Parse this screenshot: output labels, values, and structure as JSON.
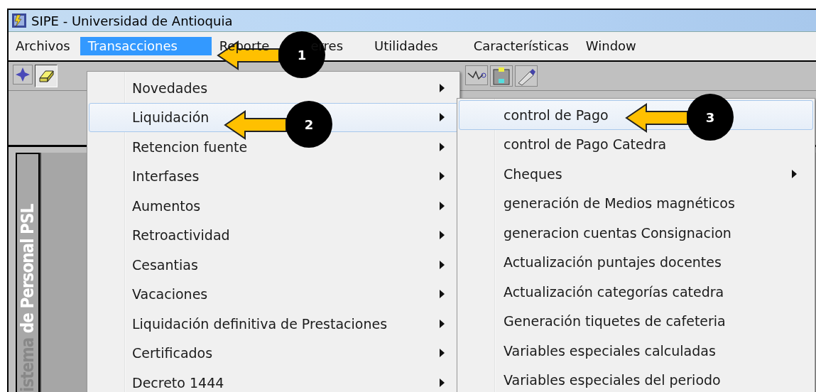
{
  "window": {
    "title": "SIPE - Universidad de Antioquia"
  },
  "menu_bar": [
    {
      "label": "Archivos",
      "selected": false
    },
    {
      "label": "Transacciones",
      "selected": true
    },
    {
      "label": "Reporte",
      "selected": false
    },
    {
      "label": "erres",
      "selected": false
    },
    {
      "label": "Utilidades",
      "selected": false
    },
    {
      "label": "Características",
      "selected": false
    },
    {
      "label": "Window",
      "selected": false
    }
  ],
  "side_banner": {
    "dim_part": "istema",
    "bright_part": "de Personal PSL"
  },
  "menu": [
    {
      "label": "Novedades",
      "selected": false,
      "submenu": true
    },
    {
      "label": "Liquidación",
      "selected": true,
      "submenu": true
    },
    {
      "label": "Retencion fuente",
      "selected": false,
      "submenu": true
    },
    {
      "label": "Interfases",
      "selected": false,
      "submenu": true
    },
    {
      "label": "Aumentos",
      "selected": false,
      "submenu": true
    },
    {
      "label": "Retroactividad",
      "selected": false,
      "submenu": true
    },
    {
      "label": "Cesantias",
      "selected": false,
      "submenu": true
    },
    {
      "label": "Vacaciones",
      "selected": false,
      "submenu": true
    },
    {
      "label": "Liquidación definitiva de Prestaciones",
      "selected": false,
      "submenu": true
    },
    {
      "label": "Certificados",
      "selected": false,
      "submenu": true
    },
    {
      "label": "Decreto 1444",
      "selected": false,
      "submenu": true
    }
  ],
  "submenu": [
    {
      "label": "control de Pago",
      "selected": true,
      "submenu": false
    },
    {
      "label": "control de Pago Catedra",
      "selected": false,
      "submenu": false
    },
    {
      "label": "Cheques",
      "selected": false,
      "submenu": true
    },
    {
      "label": "generación de Medios magnéticos",
      "selected": false,
      "submenu": false
    },
    {
      "label": "generacion cuentas Consignacion",
      "selected": false,
      "submenu": false
    },
    {
      "label": "Actualización puntajes docentes",
      "selected": false,
      "submenu": false
    },
    {
      "label": "Actualización categorías catedra",
      "selected": false,
      "submenu": false
    },
    {
      "label": "Generación tiquetes de cafeteria",
      "selected": false,
      "submenu": false
    },
    {
      "label": "Variables especiales calculadas",
      "selected": false,
      "submenu": false
    },
    {
      "label": "Variables especiales del periodo",
      "selected": false,
      "submenu": false
    }
  ],
  "callouts": [
    {
      "number": "1"
    },
    {
      "number": "2"
    },
    {
      "number": "3"
    }
  ]
}
